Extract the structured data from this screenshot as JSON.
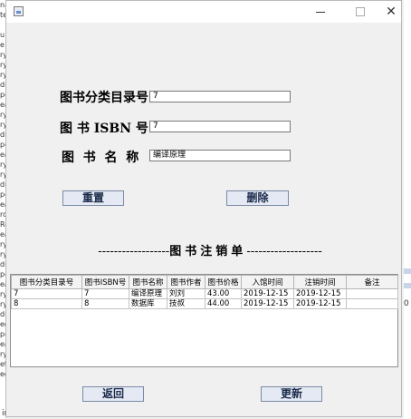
{
  "background_edges": {
    "left_letters": [
      "na",
      "te",
      "",
      "u",
      "e",
      "ry",
      "ry",
      "ry",
      "dr",
      "pc",
      "ea",
      "ry",
      "ry",
      "dr",
      "pc",
      "ea",
      "ry",
      "ry",
      "dr",
      "pc",
      "ea",
      "rc",
      "Re",
      "ea",
      "ry",
      "ry",
      "dr",
      "pc",
      "ea",
      "ry",
      "ry",
      "dr",
      "eg",
      "pc",
      "ea",
      "ry",
      "et",
      "eg"
    ],
    "bottom_text": "ingUtil.java",
    "right_mark": "0"
  },
  "window": {
    "buttons": {
      "close": "✕"
    }
  },
  "form": {
    "category_label": "图书分类目录号",
    "category_value": "7",
    "isbn_label": "图 书 ISBN 号",
    "isbn_value": "7",
    "name_label": "图  书  名  称",
    "name_value": "编译原理",
    "reset_button": "重置",
    "delete_button": "删除"
  },
  "divider": {
    "left_dashes": "------------------",
    "title": "图书注销单",
    "right_dashes": "-------------------"
  },
  "table": {
    "headers": [
      "图书分类目录号",
      "图书ISBN号",
      "图书名称",
      "图书作者",
      "图书价格",
      "入馆时间",
      "注销时间",
      "备注"
    ],
    "rows": [
      [
        "7",
        "7",
        "编译原理",
        "刘刘",
        "43.00",
        "2019-12-15",
        "2019-12-15",
        ""
      ],
      [
        "8",
        "8",
        "数据库",
        "技叔",
        "44.00",
        "2019-12-15",
        "2019-12-15",
        ""
      ]
    ]
  },
  "footer": {
    "back_button": "返回",
    "update_button": "更新"
  },
  "colors": {
    "window_bg": "#f0f0f0",
    "button_bg": "#e4e9f3",
    "button_border": "#7b8aa6"
  }
}
